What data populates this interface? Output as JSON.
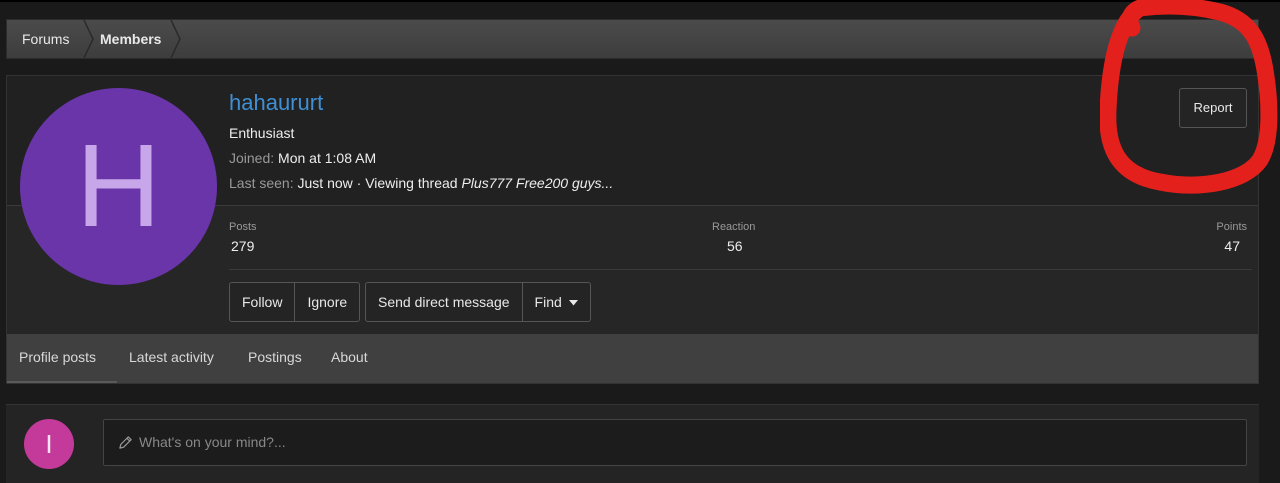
{
  "breadcrumb": {
    "items": [
      "Forums",
      "Members"
    ]
  },
  "profile": {
    "avatar_letter": "H",
    "avatar_color": "#6a35a8",
    "username": "hahaururt",
    "user_title": "Enthusiast",
    "joined_label": "Joined:",
    "joined_value": "Mon at 1:08 AM",
    "last_seen_label": "Last seen:",
    "last_seen_value": "Just now · Viewing thread",
    "last_seen_thread": "Plus777 Free200 guys...",
    "report_label": "Report"
  },
  "stats": [
    {
      "label": "Posts",
      "value": "279"
    },
    {
      "label": "Reaction",
      "value": "56"
    },
    {
      "label": "Points",
      "value": "47"
    }
  ],
  "actions": {
    "follow": "Follow",
    "ignore": "Ignore",
    "message": "Send direct message",
    "find": "Find"
  },
  "tabs": [
    "Profile posts",
    "Latest activity",
    "Postings",
    "About"
  ],
  "post_box": {
    "avatar_letter": "I",
    "placeholder": "What's on your mind?..."
  },
  "colors": {
    "accent": "#3f8fd4",
    "annotation": "#e3201c"
  }
}
